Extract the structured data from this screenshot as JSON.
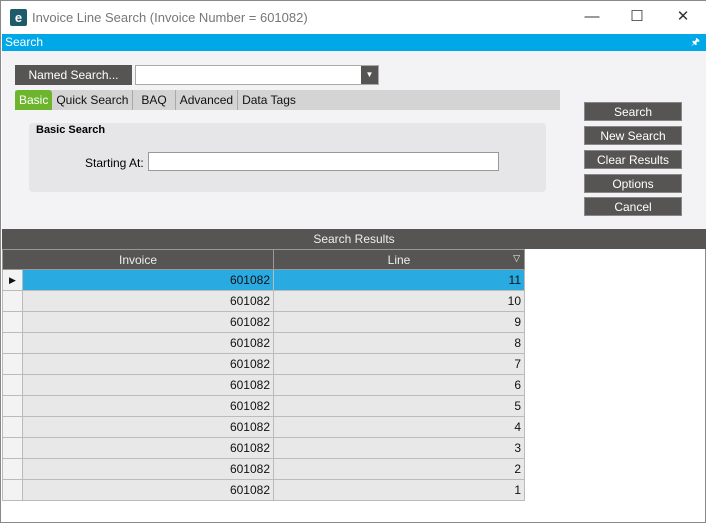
{
  "window": {
    "title": "Invoice Line Search (Invoice Number = 601082)",
    "logo": "e",
    "minimize": "—",
    "maximize": "☐",
    "close": "✕"
  },
  "search_bar": {
    "label": "Search",
    "pin": "🖈"
  },
  "named_search": {
    "label": "Named Search...",
    "value": ""
  },
  "tabs": [
    {
      "label": "Basic"
    },
    {
      "label": "Quick Search"
    },
    {
      "label": "BAQ"
    },
    {
      "label": "Advanced"
    },
    {
      "label": "Data Tags"
    }
  ],
  "basic": {
    "heading": "Basic Search",
    "starting_at_label": "Starting At:",
    "starting_at_value": ""
  },
  "buttons": {
    "search": "Search",
    "new_search": "New Search",
    "clear": "Clear Results",
    "options": "Options",
    "cancel": "Cancel"
  },
  "results": {
    "title": "Search Results",
    "columns": [
      "Invoice",
      "Line"
    ],
    "rows": [
      [
        "601082",
        "11"
      ],
      [
        "601082",
        "10"
      ],
      [
        "601082",
        "9"
      ],
      [
        "601082",
        "8"
      ],
      [
        "601082",
        "7"
      ],
      [
        "601082",
        "6"
      ],
      [
        "601082",
        "5"
      ],
      [
        "601082",
        "4"
      ],
      [
        "601082",
        "3"
      ],
      [
        "601082",
        "2"
      ],
      [
        "601082",
        "1"
      ]
    ]
  }
}
